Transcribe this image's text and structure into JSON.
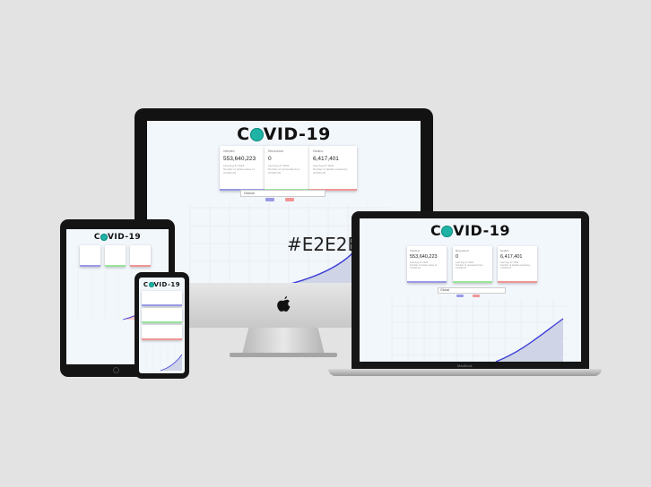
{
  "app": {
    "logo_text": "VID-19",
    "logo_prefix": "C",
    "watermark": "#E2E2E"
  },
  "stats": {
    "confirmed": {
      "label": "Infected",
      "value": "553,640,223",
      "date": "Last Aug 27 2022",
      "desc": "Number of active cases of COVID-19"
    },
    "recovered": {
      "label": "Recovered",
      "value": "0",
      "date": "Last Aug 27 2022",
      "desc": "Number of recoveries from COVID-19"
    },
    "deaths": {
      "label": "Deaths",
      "value": "6,417,401",
      "date": "Last Aug 27 2022",
      "desc": "Number of deaths caused by COVID-19"
    }
  },
  "controls": {
    "country_select": "Global",
    "legend_infected": "Infected",
    "legend_deaths": "Deaths"
  },
  "devices": {
    "laptop_brand": "MacBook"
  },
  "colors": {
    "background": "#E3E3E3",
    "screen_bg": "#F2F7FC",
    "infected_line": "#3B3BD6",
    "infected_bar": "#9A9AE6",
    "recovered_bar": "#9BE39B",
    "deaths_bar": "#F09595",
    "virus_icon": "#1FB3A5"
  },
  "icons": [
    "virus-icon",
    "apple-logo-icon",
    "chevron-down-icon"
  ]
}
